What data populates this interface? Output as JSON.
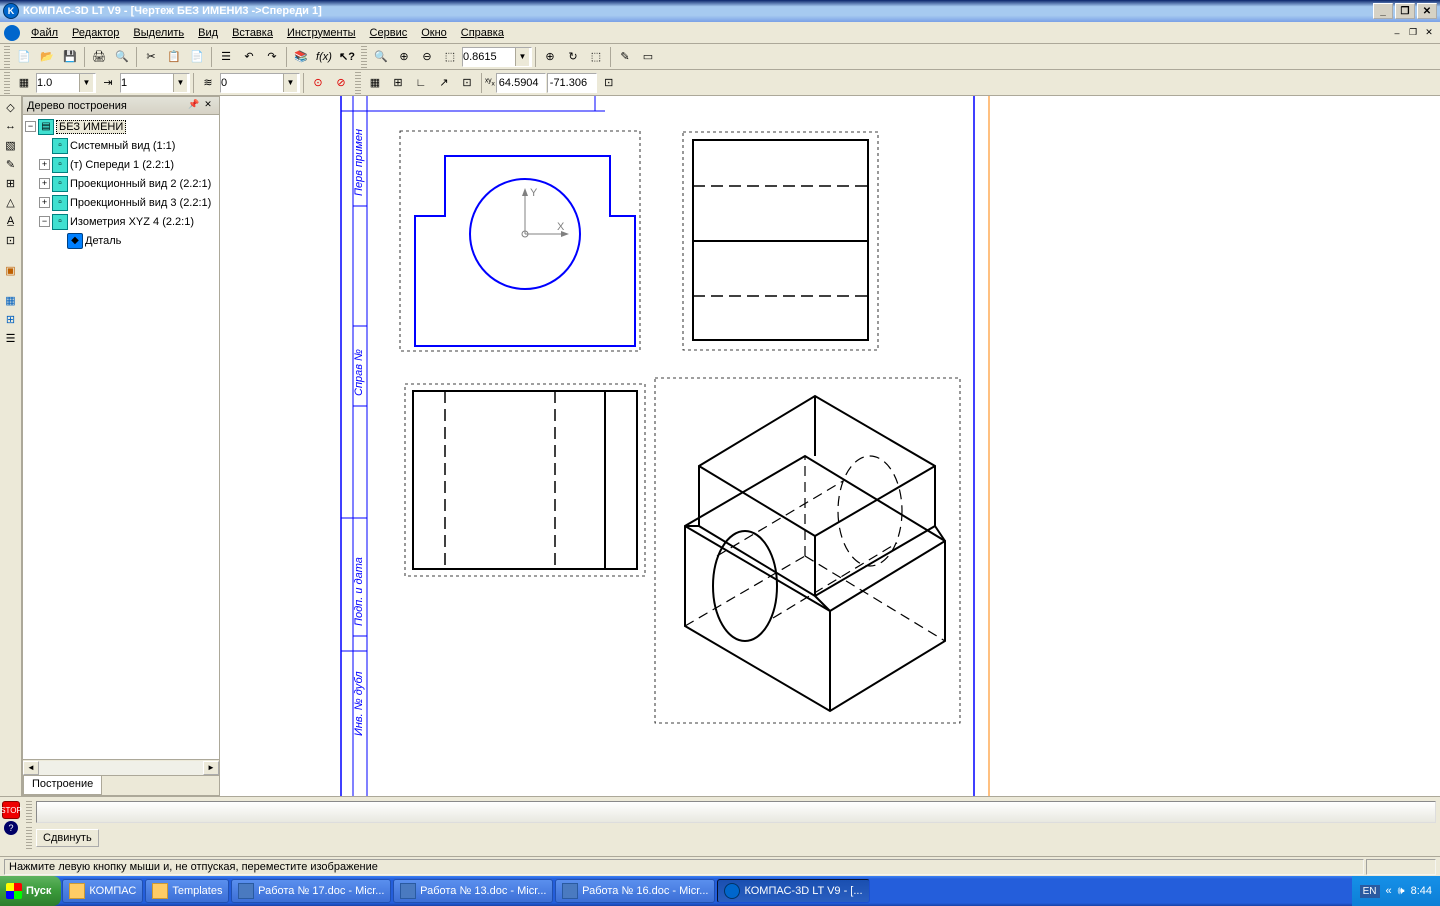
{
  "title": "КОМПАС-3D LT V9 - [Чертеж БЕЗ ИМЕНИ3 ->Спереди 1]",
  "menu": [
    "Файл",
    "Редактор",
    "Выделить",
    "Вид",
    "Вставка",
    "Инструменты",
    "Сервис",
    "Окно",
    "Справка"
  ],
  "toolbar2": {
    "zoom": "0.8615",
    "coord_x": "64.5904",
    "coord_y": "-71.306"
  },
  "toolbar3": {
    "val1": "1.0",
    "val2": "1",
    "val3": "0"
  },
  "tree": {
    "title": "Дерево построения",
    "root": "БЕЗ ИМЕНИ",
    "items": [
      "Системный вид (1:1)",
      "(т) Спереди 1 (2.2:1)",
      "Проекционный вид 2 (2.2:1)",
      "Проекционный вид 3 (2.2:1)",
      "Изометрия XYZ 4 (2.2:1)"
    ],
    "detail": "Деталь",
    "tab": "Построение"
  },
  "bottom": {
    "btn": "Сдвинуть"
  },
  "status": "Нажмите левую кнопку мыши и, не отпуская, переместите изображение",
  "taskbar": {
    "start": "Пуск",
    "tasks": [
      {
        "label": "КОМПАС",
        "icon": "folder"
      },
      {
        "label": "Templates",
        "icon": "folder"
      },
      {
        "label": "Работа № 17.doc - Micr...",
        "icon": "word"
      },
      {
        "label": "Работа № 13.doc - Micr...",
        "icon": "word"
      },
      {
        "label": "Работа № 16.doc - Micr...",
        "icon": "word"
      },
      {
        "label": "КОМПАС-3D LT V9 - [...",
        "icon": "kompas",
        "active": true
      }
    ],
    "lang": "EN",
    "time": "8:44"
  }
}
